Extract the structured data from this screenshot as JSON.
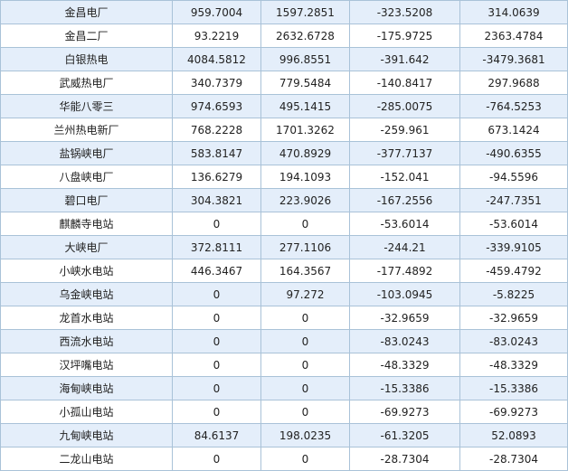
{
  "table": {
    "rows": [
      {
        "name": "金昌电厂",
        "v1": "959.7004",
        "v2": "1597.2851",
        "v3": "-323.5208",
        "v4": "314.0639"
      },
      {
        "name": "金昌二厂",
        "v1": "93.2219",
        "v2": "2632.6728",
        "v3": "-175.9725",
        "v4": "2363.4784"
      },
      {
        "name": "白银热电",
        "v1": "4084.5812",
        "v2": "996.8551",
        "v3": "-391.642",
        "v4": "-3479.3681"
      },
      {
        "name": "武威热电厂",
        "v1": "340.7379",
        "v2": "779.5484",
        "v3": "-140.8417",
        "v4": "297.9688"
      },
      {
        "name": "华能八零三",
        "v1": "974.6593",
        "v2": "495.1415",
        "v3": "-285.0075",
        "v4": "-764.5253"
      },
      {
        "name": "兰州热电新厂",
        "v1": "768.2228",
        "v2": "1701.3262",
        "v3": "-259.961",
        "v4": "673.1424"
      },
      {
        "name": "盐锅峡电厂",
        "v1": "583.8147",
        "v2": "470.8929",
        "v3": "-377.7137",
        "v4": "-490.6355"
      },
      {
        "name": "八盘峡电厂",
        "v1": "136.6279",
        "v2": "194.1093",
        "v3": "-152.041",
        "v4": "-94.5596"
      },
      {
        "name": "碧口电厂",
        "v1": "304.3821",
        "v2": "223.9026",
        "v3": "-167.2556",
        "v4": "-247.7351"
      },
      {
        "name": "麒麟寺电站",
        "v1": "0",
        "v2": "0",
        "v3": "-53.6014",
        "v4": "-53.6014"
      },
      {
        "name": "大峡电厂",
        "v1": "372.8111",
        "v2": "277.1106",
        "v3": "-244.21",
        "v4": "-339.9105"
      },
      {
        "name": "小峡水电站",
        "v1": "446.3467",
        "v2": "164.3567",
        "v3": "-177.4892",
        "v4": "-459.4792"
      },
      {
        "name": "乌金峡电站",
        "v1": "0",
        "v2": "97.272",
        "v3": "-103.0945",
        "v4": "-5.8225"
      },
      {
        "name": "龙首水电站",
        "v1": "0",
        "v2": "0",
        "v3": "-32.9659",
        "v4": "-32.9659"
      },
      {
        "name": "西流水电站",
        "v1": "0",
        "v2": "0",
        "v3": "-83.0243",
        "v4": "-83.0243"
      },
      {
        "name": "汉坪嘴电站",
        "v1": "0",
        "v2": "0",
        "v3": "-48.3329",
        "v4": "-48.3329"
      },
      {
        "name": "海甸峡电站",
        "v1": "0",
        "v2": "0",
        "v3": "-15.3386",
        "v4": "-15.3386"
      },
      {
        "name": "小孤山电站",
        "v1": "0",
        "v2": "0",
        "v3": "-69.9273",
        "v4": "-69.9273"
      },
      {
        "name": "九甸峡电站",
        "v1": "84.6137",
        "v2": "198.0235",
        "v3": "-61.3205",
        "v4": "52.0893"
      },
      {
        "name": "二龙山电站",
        "v1": "0",
        "v2": "0",
        "v3": "-28.7304",
        "v4": "-28.7304"
      }
    ]
  },
  "colors": {
    "row_alt": "#e4eefa",
    "row_plain": "#ffffff",
    "border": "#a9c2d8"
  }
}
